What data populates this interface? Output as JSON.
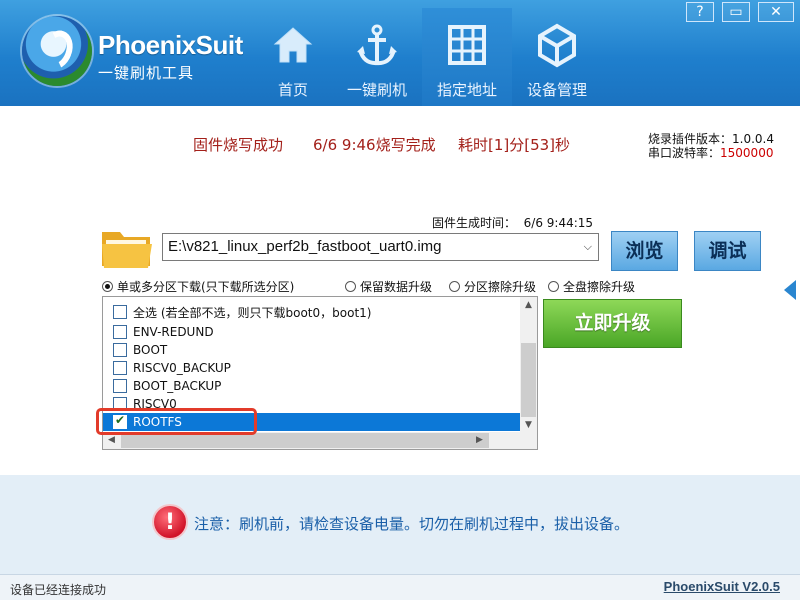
{
  "app": {
    "brand": "PhoenixSuit",
    "subtitle": "一键刷机工具",
    "version_link": "PhoenixSuit V2.0.5"
  },
  "window_buttons": [
    "?",
    "▭",
    "✕"
  ],
  "nav": [
    {
      "label": "首页",
      "icon": "home-icon",
      "active": false
    },
    {
      "label": "一键刷机",
      "icon": "anchor-icon",
      "active": false
    },
    {
      "label": "指定地址",
      "icon": "grid-icon",
      "active": true
    },
    {
      "label": "设备管理",
      "icon": "device-icon",
      "active": false
    }
  ],
  "status": {
    "result": "固件烧写成功",
    "finished": "6/6 9:46烧写完成",
    "elapsed": "耗时[1]分[53]秒"
  },
  "plugin": {
    "version_label": "烧录插件版本：",
    "version_value": "1.0.0.4",
    "baud_label": "串口波特率：",
    "baud_value": "1500000"
  },
  "firmware": {
    "gen_time_label": "固件生成时间：",
    "gen_time_value": "6/6 9:44:15",
    "file_path": "E:\\v821_linux_perf2b_fastboot_uart0.img"
  },
  "buttons": {
    "browse": "浏览",
    "debug": "调试",
    "upgrade": "立即升级"
  },
  "download_modes": [
    {
      "label": "单或多分区下载(只下载所选分区)",
      "selected": true
    },
    {
      "label": "保留数据升级",
      "selected": false
    },
    {
      "label": "分区擦除升级",
      "selected": false
    },
    {
      "label": "全盘擦除升级",
      "selected": false
    }
  ],
  "partitions": {
    "select_all": "全选 (若全部不选，则只下载boot0，boot1)",
    "items": [
      {
        "name": "ENV-REDUND",
        "checked": false,
        "selected": false
      },
      {
        "name": "BOOT",
        "checked": false,
        "selected": false
      },
      {
        "name": "RISCV0_BACKUP",
        "checked": false,
        "selected": false
      },
      {
        "name": "BOOT_BACKUP",
        "checked": false,
        "selected": false
      },
      {
        "name": "RISCV0",
        "checked": false,
        "selected": false
      },
      {
        "name": "ROOTFS",
        "checked": true,
        "selected": true
      }
    ]
  },
  "notice": "注意：刷机前，请检查设备电量。切勿在刷机过程中，拔出设备。",
  "footer_status": "设备已经连接成功",
  "colors": {
    "header_blue": "#1f7fcd",
    "status_red": "#a3201a",
    "selected_row": "#0c78d7",
    "upgrade_green": "#4aa626",
    "notice_blue": "#1a5fa8",
    "highlight_red": "#e23b2a"
  }
}
